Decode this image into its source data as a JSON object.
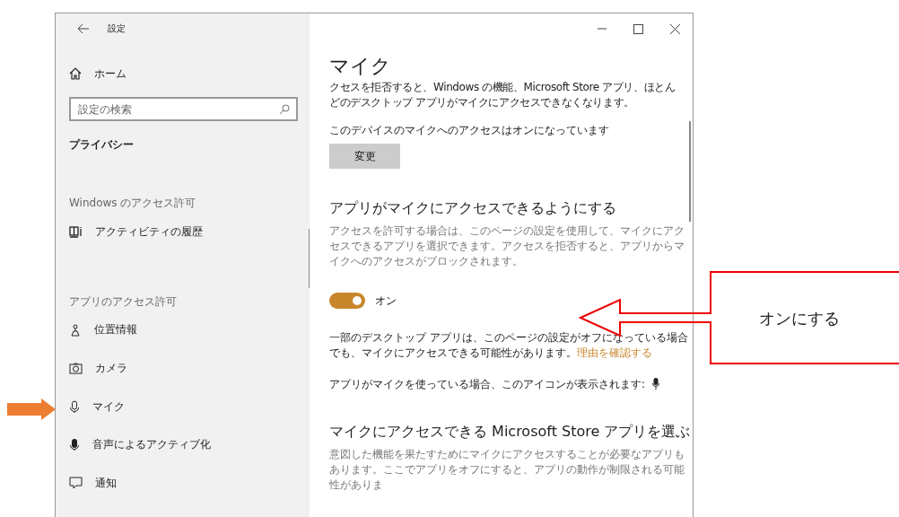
{
  "window": {
    "title": "設定"
  },
  "sidebar": {
    "home": "ホーム",
    "search": {
      "placeholder": "設定の検索"
    },
    "heading": "プライバシー",
    "groups": [
      {
        "title": "Windows のアクセス許可",
        "items": [
          {
            "label": "アクティビティの履歴",
            "kind": "history"
          }
        ]
      },
      {
        "title": "アプリのアクセス許可",
        "items": [
          {
            "label": "位置情報",
            "kind": "location"
          },
          {
            "label": "カメラ",
            "kind": "camera"
          },
          {
            "label": "マイク",
            "kind": "mic"
          },
          {
            "label": "音声によるアクティブ化",
            "kind": "voice"
          },
          {
            "label": "通知",
            "kind": "notification"
          }
        ]
      }
    ]
  },
  "content": {
    "title": "マイク",
    "intro_lines": [
      "クセスを拒否すると、Windows の機能、Microsoft Store アプリ、ほとん",
      "どのデスクトップ アプリがマイクにアクセスできなくなります。"
    ],
    "device_status": "このデバイスのマイクへのアクセスはオンになっています",
    "change_button": "変更",
    "section1": {
      "heading": "アプリがマイクにアクセスできるようにする",
      "description": "アクセスを許可する場合は、このページの設定を使用して、マイクにアクセスできるアプリを選択できます。アクセスを拒否すると、アプリからマイクへのアクセスがブロックされます。"
    },
    "toggle": {
      "on": true,
      "label": "オン"
    },
    "desktop_note": "一部のデスクトップ アプリは、このページの設定がオフになっている場合でも、マイクにアクセスできる可能性があります。",
    "desktop_link": "理由を確認する",
    "icon_note": "アプリがマイクを使っている場合、このアイコンが表示されます:",
    "section2": {
      "heading": "マイクにアクセスできる Microsoft Store アプリを選ぶ",
      "description": "意図した機能を果たすためにマイクにアクセスすることが必要なアプリもあります。ここでアプリをオフにすると、アプリの動作が制限される可能性がありま"
    }
  },
  "annotation": {
    "callout": "オンにする"
  }
}
